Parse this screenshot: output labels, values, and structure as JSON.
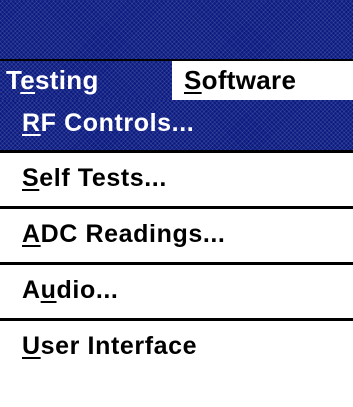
{
  "menubar": {
    "menus": [
      {
        "mnemonic_pre": "T",
        "mnemonic": "e",
        "rest": "sting",
        "active": true
      },
      {
        "mnemonic_pre": "",
        "mnemonic": "S",
        "rest": "oftware",
        "active": false
      }
    ]
  },
  "dropdown": {
    "items": [
      {
        "pre": "",
        "mnemonic": "R",
        "rest": "F Controls...",
        "highlighted": true
      },
      {
        "pre": "",
        "mnemonic": "S",
        "rest": "elf Tests...",
        "highlighted": false
      },
      {
        "pre": "",
        "mnemonic": "A",
        "rest": "DC Readings...",
        "highlighted": false
      },
      {
        "pre": "A",
        "mnemonic": "u",
        "rest": "dio...",
        "highlighted": false
      },
      {
        "pre": "",
        "mnemonic": "U",
        "rest": "ser Interface",
        "highlighted": false
      }
    ]
  },
  "colors": {
    "highlight": "#0a1a80",
    "separator": "#000000",
    "background": "#ffffff"
  }
}
